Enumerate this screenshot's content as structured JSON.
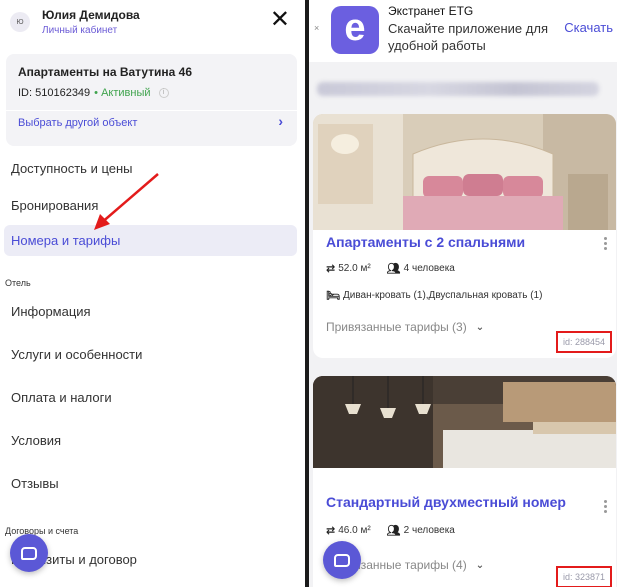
{
  "sidebar": {
    "user": {
      "initials": "Ю",
      "name": "Юлия Демидова",
      "subtitle": "Личный кабинет"
    },
    "close_icon": "✕",
    "object": {
      "title": "Апартаменты на Ватутина 46",
      "id_label": "ID: 510162349",
      "status": "• Активный",
      "switch_label": "Выбрать другой объект"
    },
    "menu": {
      "availability": "Доступность и цены",
      "bookings": "Бронирования",
      "rooms": "Номера и тарифы"
    },
    "hotel_section": "Отель",
    "hotel_items": {
      "info": "Информация",
      "services": "Услуги и особенности",
      "payment": "Оплата и налоги",
      "conditions": "Условия",
      "reviews": "Отзывы"
    },
    "contracts_section": "Договоры и счета",
    "contracts_item": "Реквизиты и договор"
  },
  "banner": {
    "logo_letter": "e",
    "title": "Экстранет ETG",
    "text": "Скачайте приложение для удобной работы",
    "download": "Скачать",
    "close": "×"
  },
  "rooms": [
    {
      "title": "Апартаменты с 2 спальнями",
      "area": "52.0 м²",
      "guests": "4 человека",
      "beds": "Диван-кровать (1),Двуспальная кровать (1)",
      "tariffs": "Привязанные тарифы (3)",
      "id": "id: 288454"
    },
    {
      "title": "Стандартный двухместный номер",
      "area": "46.0 м²",
      "guests": "2 человека",
      "tariffs": "Привязанные тарифы (4)",
      "id": "id: 323871"
    }
  ],
  "colors": {
    "accent": "#4a4cd6",
    "status": "#3fa34d",
    "highlight": "#e31b1b",
    "chat": "#5b58d6"
  },
  "icons": [
    "close-icon",
    "chevron-right-icon",
    "info-icon",
    "chat-icon",
    "area-icon",
    "guests-icon",
    "bed-icon",
    "chevron-down-icon",
    "more-icon",
    "app-logo-icon"
  ]
}
